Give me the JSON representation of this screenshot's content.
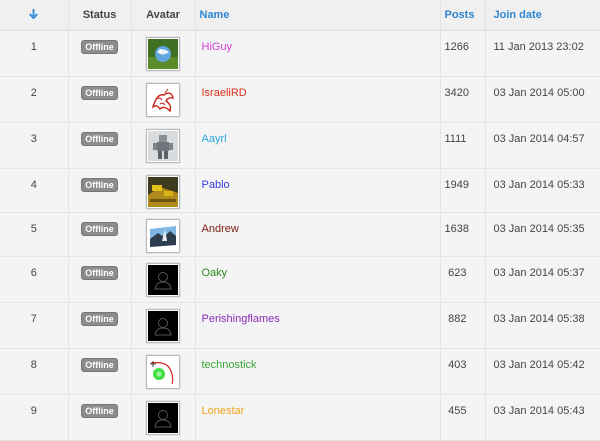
{
  "header": {
    "rank_icon": "sort-down-arrow-icon",
    "status": "Status",
    "avatar": "Avatar",
    "name": "Name",
    "posts": "Posts",
    "join_date": "Join date"
  },
  "rows": [
    {
      "rank": "1",
      "status": "Offline",
      "avatar": "globe-avatar",
      "name": "HiGuy",
      "color": "#d23cd6",
      "posts": "1266",
      "join": "11 Jan 2013 23:02"
    },
    {
      "rank": "2",
      "status": "Offline",
      "avatar": "red-dragon-avatar",
      "name": "IsraeliRD",
      "color": "#d9301c",
      "posts": "3420",
      "join": "03 Jan 2014 05:00"
    },
    {
      "rank": "3",
      "status": "Offline",
      "avatar": "robot-avatar",
      "name": "Aayrl",
      "color": "#2aa8df",
      "posts": "1111",
      "join": "03 Jan 2014 04:57"
    },
    {
      "rank": "4",
      "status": "Offline",
      "avatar": "game-scene-avatar",
      "name": "Pablo",
      "color": "#3b3be0",
      "posts": "1949",
      "join": "03 Jan 2014 05:33"
    },
    {
      "rank": "5",
      "status": "Offline",
      "avatar": "landscape-avatar",
      "name": "Andrew",
      "color": "#7a1c12",
      "posts": "1638",
      "join": "03 Jan 2014 05:35"
    },
    {
      "rank": "6",
      "status": "Offline",
      "avatar": "default-user-avatar",
      "name": "Oaky",
      "color": "#2f8a1e",
      "posts": "623",
      "join": "03 Jan 2014 05:37"
    },
    {
      "rank": "7",
      "status": "Offline",
      "avatar": "default-user-avatar",
      "name": "Perishingflames",
      "color": "#8a2bb5",
      "posts": "882",
      "join": "03 Jan 2014 05:38"
    },
    {
      "rank": "8",
      "status": "Offline",
      "avatar": "marble-path-avatar",
      "name": "technostick",
      "color": "#3aa53a",
      "posts": "403",
      "join": "03 Jan 2014 05:42"
    },
    {
      "rank": "9",
      "status": "Offline",
      "avatar": "default-user-avatar",
      "name": "Lonestar",
      "color": "#f0a41a",
      "posts": "455",
      "join": "03 Jan 2014 05:43"
    }
  ]
}
